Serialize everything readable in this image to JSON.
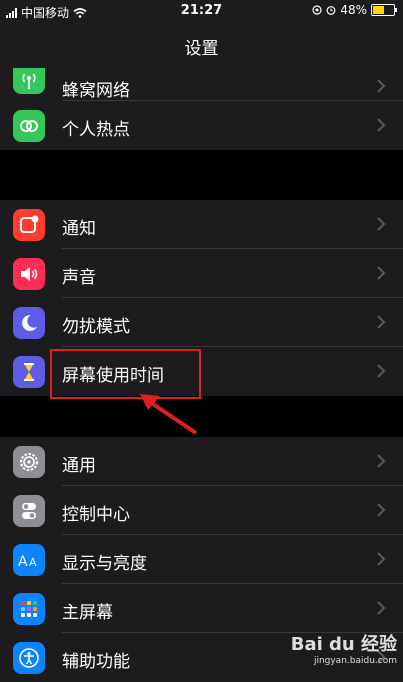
{
  "status_bar": {
    "carrier": "中国移动",
    "time": "21:27",
    "battery_percent": "48%",
    "battery_level": 0.48
  },
  "nav": {
    "title": "设置"
  },
  "groups": [
    {
      "items": [
        {
          "label": "蜂窝网络",
          "icon": "antenna-icon",
          "color": "#34c759"
        },
        {
          "label": "个人热点",
          "icon": "hotspot-icon",
          "color": "#34c759"
        }
      ]
    },
    {
      "items": [
        {
          "label": "通知",
          "icon": "notification-icon",
          "color": "#ff3b30"
        },
        {
          "label": "声音",
          "icon": "speaker-icon",
          "color": "#ff2d55"
        },
        {
          "label": "勿扰模式",
          "icon": "moon-icon",
          "color": "#5e5ce6"
        },
        {
          "label": "屏幕使用时间",
          "icon": "hourglass-icon",
          "color": "#5e5ce6"
        }
      ]
    },
    {
      "items": [
        {
          "label": "通用",
          "icon": "gear-icon",
          "color": "#8e8e93"
        },
        {
          "label": "控制中心",
          "icon": "switches-icon",
          "color": "#8e8e93"
        },
        {
          "label": "显示与亮度",
          "icon": "text-size-icon",
          "color": "#0a84ff"
        },
        {
          "label": "主屏幕",
          "icon": "app-grid-icon",
          "color": "#0a84ff"
        },
        {
          "label": "辅助功能",
          "icon": "accessibility-icon",
          "color": "#0a84ff"
        }
      ]
    }
  ],
  "watermark": {
    "text": "Bai du 经验",
    "sub": "jingyan.baidu.com"
  }
}
